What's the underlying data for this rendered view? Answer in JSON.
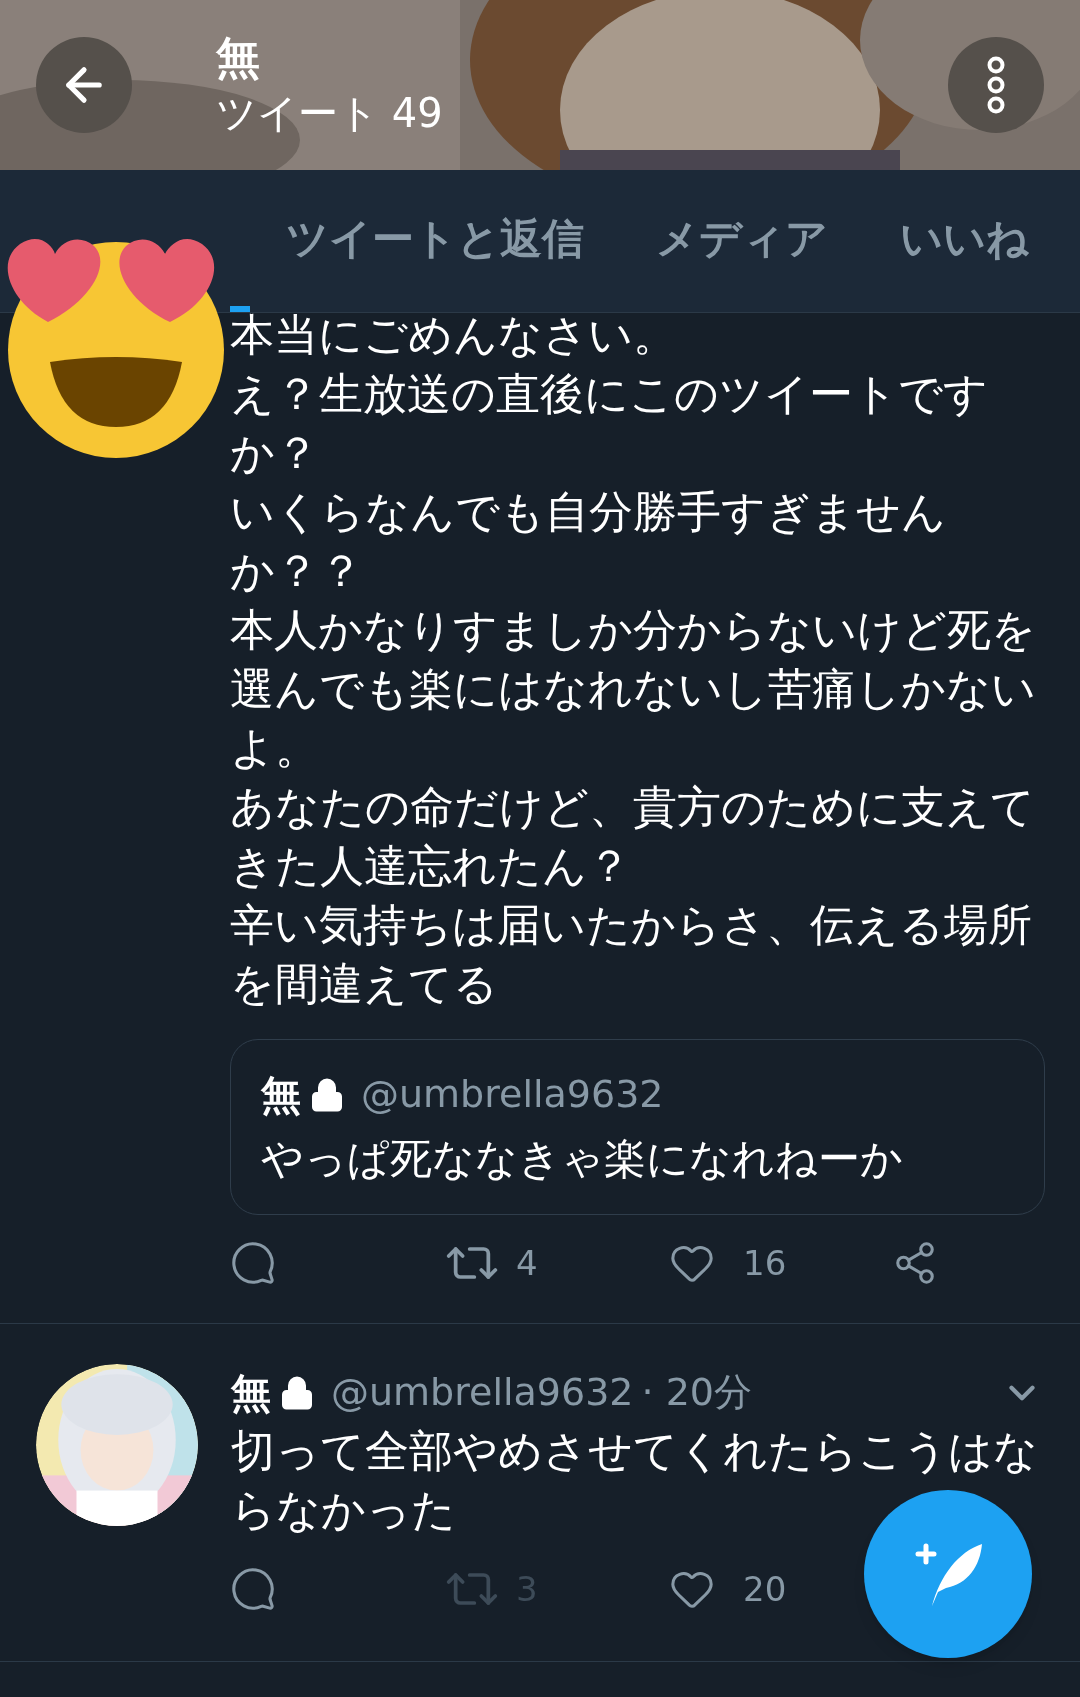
{
  "header": {
    "name": "無",
    "tweet_count": "ツイート 49"
  },
  "tabs": [
    {
      "selected": true
    },
    {
      "label": "ツイートと返信",
      "selected": false
    },
    {
      "label": "メディア",
      "selected": false
    },
    {
      "label": "いいね",
      "selected": false
    }
  ],
  "tweets": [
    {
      "body": [
        "本当にごめんなさい。",
        "え？生放送の直後にこのツイートですか？",
        "いくらなんでも自分勝手すぎませんか？？",
        "本人かなりすましか分からないけど死を選んでも楽にはなれないし苦痛しかないよ。",
        "あなたの命だけど、貴方のために支えてきた人達忘れたん？",
        "辛い気持ちは届いたからさ、伝える場所を間違えてる"
      ],
      "quote": {
        "name": "無",
        "handle": "@umbrella9632",
        "text": "やっぱ死ななきゃ楽になれねーか"
      },
      "actions": {
        "retweets": "4",
        "retweet_disabled": false,
        "likes": "16",
        "share": true
      }
    },
    {
      "avatar": {
        "kind": "picture"
      },
      "name": "無",
      "handle": "@umbrella9632",
      "time": "· 20分",
      "body": [
        "切って全部やめさせてくれたらこうはならなかった"
      ],
      "actions": {
        "retweets": "3",
        "retweet_disabled": true,
        "likes": "20"
      }
    }
  ]
}
